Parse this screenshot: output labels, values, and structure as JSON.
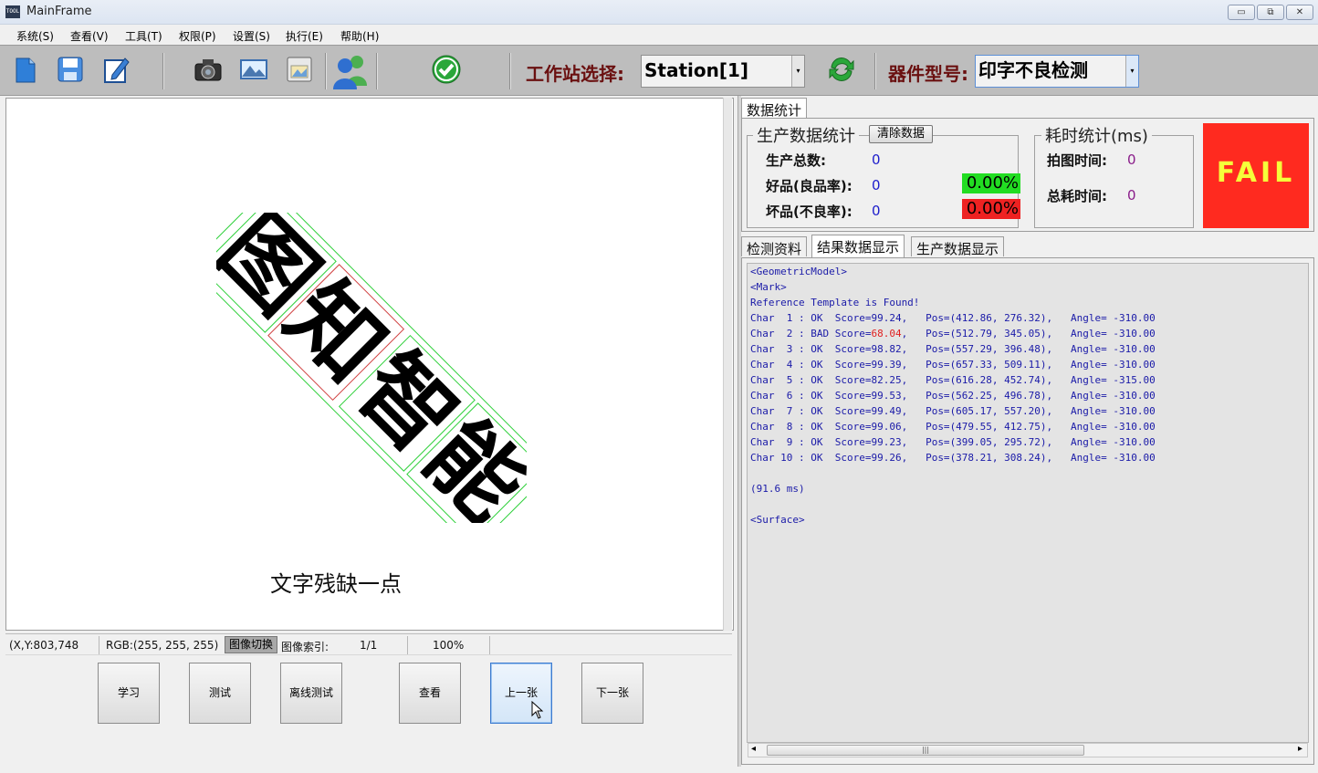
{
  "window": {
    "title": "MainFrame",
    "app_icon_text": "TOOL",
    "btn_minimize": "▭",
    "btn_maximize": "⧉",
    "btn_close": "✕"
  },
  "menu": [
    "系统(S)",
    "查看(V)",
    "工具(T)",
    "权限(P)",
    "设置(S)",
    "执行(E)",
    "帮助(H)"
  ],
  "toolbar": {
    "station_label": "工作站选择:",
    "station_value": "Station[1]",
    "part_label": "器件型号:",
    "part_value": "印字不良检测",
    "combo_arrow": "▾"
  },
  "image": {
    "characters": [
      "图",
      "知",
      "智",
      "能"
    ],
    "caption": "文字残缺一点"
  },
  "status": {
    "xy": "(X,Y:803,748",
    "rgb": "RGB:(255, 255, 255)",
    "switch_label": "图像切换",
    "index_label": "图像索引:",
    "index_value": "1/1",
    "zoom": "100%"
  },
  "buttons": {
    "learn": "学习",
    "test": "测试",
    "offline_test": "离线测试",
    "view": "查看",
    "prev": "上一张",
    "next": "下一张"
  },
  "stats": {
    "tab_label": "数据统计",
    "production_title": "生产数据统计",
    "clear_button": "清除数据",
    "total_label": "生产总数:",
    "total_value": "0",
    "good_label": "好品(良品率):",
    "good_value": "0",
    "good_pct": "0.00%",
    "bad_label": "坏品(不良率):",
    "bad_value": "0",
    "bad_pct": "0.00%",
    "timing_title": "耗时统计(ms)",
    "capture_label": "拍图时间:",
    "capture_value": "0",
    "total_time_label": "总耗时间:",
    "total_time_value": "0",
    "result": "FAIL",
    "good_color": "#22dd22",
    "bad_color": "#ee2222",
    "fail_color": "#ff2a1f"
  },
  "result_tabs": [
    "检测资料",
    "结果数据显示",
    "生产数据显示"
  ],
  "result": {
    "header_lines": [
      "<GeometricModel>",
      "<Mark>",
      "Reference Template is Found!"
    ],
    "chars": [
      {
        "label": "Char  1 : OK ",
        "score": "99.24",
        "bad": false,
        "pos": "(412.86, 276.32)",
        "angle": "-310.00"
      },
      {
        "label": "Char  2 : BAD",
        "score": "68.04",
        "bad": true,
        "pos": "(512.79, 345.05)",
        "angle": "-310.00"
      },
      {
        "label": "Char  3 : OK ",
        "score": "98.82",
        "bad": false,
        "pos": "(557.29, 396.48)",
        "angle": "-310.00"
      },
      {
        "label": "Char  4 : OK ",
        "score": "99.39",
        "bad": false,
        "pos": "(657.33, 509.11)",
        "angle": "-310.00"
      },
      {
        "label": "Char  5 : OK ",
        "score": "82.25",
        "bad": false,
        "pos": "(616.28, 452.74)",
        "angle": "-315.00"
      },
      {
        "label": "Char  6 : OK ",
        "score": "99.53",
        "bad": false,
        "pos": "(562.25, 496.78)",
        "angle": "-310.00"
      },
      {
        "label": "Char  7 : OK ",
        "score": "99.49",
        "bad": false,
        "pos": "(605.17, 557.20)",
        "angle": "-310.00"
      },
      {
        "label": "Char  8 : OK ",
        "score": "99.06",
        "bad": false,
        "pos": "(479.55, 412.75)",
        "angle": "-310.00"
      },
      {
        "label": "Char  9 : OK ",
        "score": "99.23",
        "bad": false,
        "pos": "(399.05, 295.72)",
        "angle": "-310.00"
      },
      {
        "label": "Char 10 : OK ",
        "score": "99.26",
        "bad": false,
        "pos": "(378.21, 308.24)",
        "angle": "-310.00"
      }
    ],
    "time_line": "(91.6 ms)",
    "surface_line": "<Surface>"
  },
  "scroll": {
    "left_arrow": "◂",
    "right_arrow": "▸",
    "grip": "|||"
  }
}
